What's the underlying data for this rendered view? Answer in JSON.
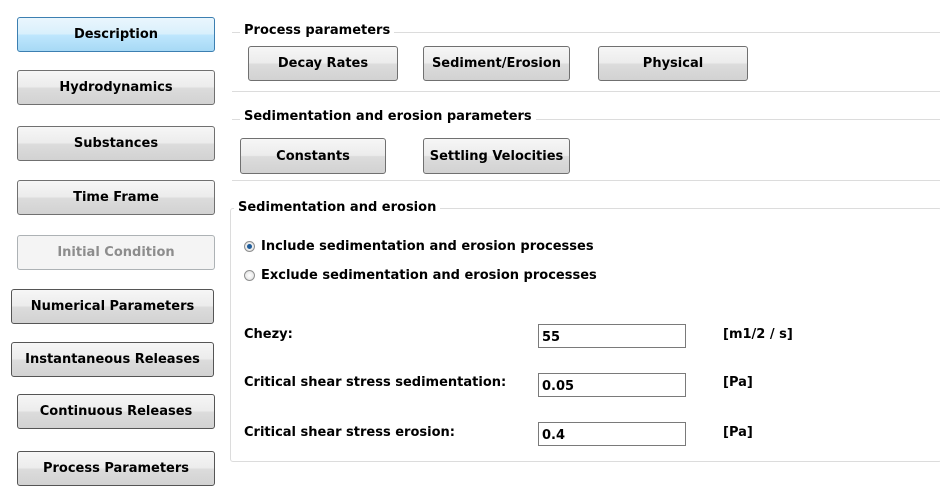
{
  "nav": {
    "description": "Description",
    "hydrodynamics": "Hydrodynamics",
    "substances": "Substances",
    "time_frame": "Time Frame",
    "initial_condition": "Initial Condition",
    "numerical_parameters": "Numerical Parameters",
    "instantaneous_releases": "Instantaneous Releases",
    "continuous_releases": "Continuous Releases",
    "process_parameters": "Process Parameters",
    "selected": "description",
    "disabled": "initial_condition"
  },
  "process_parameters": {
    "title": "Process parameters",
    "decay_rates": "Decay Rates",
    "sediment_erosion": "Sediment/Erosion",
    "physical": "Physical"
  },
  "sed_erosion_parameters": {
    "title": "Sedimentation and erosion parameters",
    "constants": "Constants",
    "settling_velocities": "Settling Velocities"
  },
  "sed_erosion": {
    "title": "Sedimentation and erosion",
    "include_label": "Include sedimentation and erosion processes",
    "exclude_label": "Exclude sedimentation and erosion processes",
    "selected_option": "include",
    "chezy": {
      "label": "Chezy:",
      "value": "55",
      "unit": "[m1/2 / s]"
    },
    "critical_sedimentation": {
      "label": "Critical shear stress sedimentation:",
      "value": "0.05",
      "unit": "[Pa]"
    },
    "critical_erosion": {
      "label": "Critical shear stress erosion:",
      "value": "0.4",
      "unit": "[Pa]"
    }
  },
  "colors": {
    "selected_button": "#bee6fd",
    "selected_border": "#3c7fb1",
    "disabled_text": "#8d8d8d",
    "radio_dot": "#1f5c99"
  }
}
